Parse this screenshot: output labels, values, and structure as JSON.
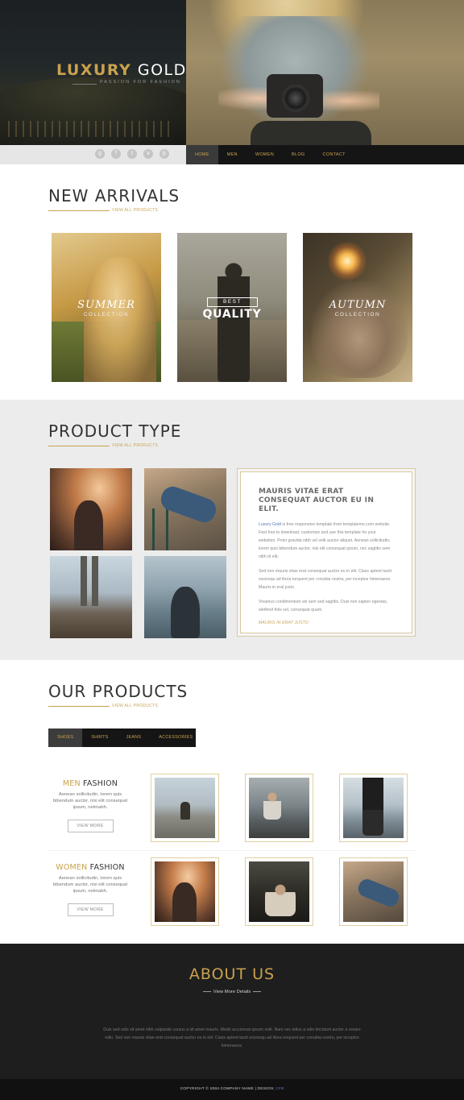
{
  "brand": {
    "name_gold": "LUXURY",
    "name_white": "GOLD",
    "tagline": "PASSION FOR FASHION"
  },
  "socials": [
    {
      "icon": "google-plus-icon",
      "glyph": "g"
    },
    {
      "icon": "facebook-icon",
      "glyph": "f"
    },
    {
      "icon": "twitter-icon",
      "glyph": "t"
    },
    {
      "icon": "vimeo-icon",
      "glyph": "v"
    },
    {
      "icon": "pinterest-icon",
      "glyph": "p"
    }
  ],
  "nav": {
    "items": [
      "HOME",
      "MEN",
      "WOMEN",
      "BLOG",
      "CONTACT"
    ],
    "active": "HOME"
  },
  "new_arrivals": {
    "title": "NEW ARRIVALS",
    "link": "VIEW ALL PRODUCTS",
    "cards": [
      {
        "script": "SUMMER",
        "sub": "COLLECTION"
      },
      {
        "best": "BEST",
        "quality": "QUALITY"
      },
      {
        "script": "AUTUMN",
        "sub": "COLLECTION"
      }
    ]
  },
  "product_type": {
    "title": "PRODUCT TYPE",
    "link": "VIEW ALL PRODUCTS",
    "card": {
      "heading": "MAURIS VITAE ERAT CONSEQUAT AUCTOR EU IN ELIT.",
      "p1_link": "Luxury Gold",
      "p1_rest": " is free responsive template from templatemo.com website. Feel free to download, customize and use this template for your websites. Proin gravida nibh vel velit auctor aliquet. Aenean sollicitudin, lorem quis bibendum auctor, nisi elit consequat ipsum, nec sagittis sem nibh id elit.",
      "p2": "Sed non mauris vitae erat consequat auctor eu in elit. Class aptent taciti sociosqu ad litora torquent per conubia nostra, per inceptos himenaeos. Mauris in erat justo.",
      "p3": "Vivamus condimentum vel sem sed sagittis. Duis non sapien egestas, eleifend felis vel, consequat quam.",
      "link": "MAURIS IN ERAT JUSTO"
    }
  },
  "our_products": {
    "title": "OUR PRODUCTS",
    "link": "VIEW ALL PRODUCTS",
    "tabs": [
      "SHOES",
      "SHIRTS",
      "JEANS",
      "ACCESSORIES"
    ],
    "active_tab": "SHOES",
    "rows": [
      {
        "gold": "MEN",
        "rest": "FASHION",
        "desc": "Aenean sollicitudin, lorem quis bibendum auctor, nisi elit consequat ipsum, netmabh.",
        "button": "VIEW MORE"
      },
      {
        "gold": "WOMEN",
        "rest": "FASHION",
        "desc": "Aenean sollicitudin, lorem quis bibendum auctor, nisi elit consequat ipsum, netmabh.",
        "button": "VIEW MORE"
      }
    ]
  },
  "about": {
    "title": "ABOUT US",
    "sub": "View More Details",
    "text": "Duis sed odio sit amet nibh vulputate cursus a sit amet mauris. Morbi accumsan ipsum velit. Nam nec tellus a odio tincidunt auctor a ornare odio. Sed non mauris vitae erat consequat auctor eu in elit. Class aptent taciti sociosqu ad litora torquent per conubia nostra, per inceptos himenaeos."
  },
  "footer": {
    "copyright": "COPYRIGHT © 2084 COMPANY NAME | DESIGN: ",
    "design": "CFB"
  },
  "colors": {
    "gold": "#c9a24e",
    "dark": "#151515",
    "band": "#ececec",
    "link_blue": "#5a7ab8"
  }
}
